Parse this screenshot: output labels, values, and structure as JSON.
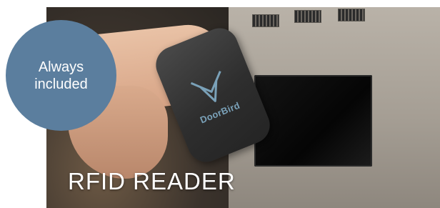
{
  "badge": {
    "line1": "Always",
    "line2": "included",
    "color": "#5b7e9e"
  },
  "card": {
    "title": "RFID READER"
  },
  "fob": {
    "brand": "DoorBird",
    "logo_icon": "doorbird-logo-icon"
  }
}
